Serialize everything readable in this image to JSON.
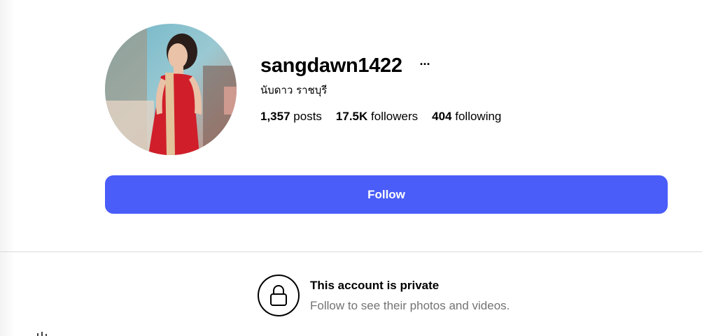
{
  "profile": {
    "username": "sangdawn1422",
    "more_icon": "···",
    "full_name": "นับดาว ราชบุรี",
    "avatar_icon": "profile-photo"
  },
  "stats": {
    "posts_count": "1,357",
    "posts_label": "posts",
    "followers_count": "17.5K",
    "followers_label": "followers",
    "following_count": "404",
    "following_label": "following"
  },
  "actions": {
    "follow_label": "Follow"
  },
  "private_notice": {
    "icon": "lock-icon",
    "title": "This account is private",
    "subtitle": "Follow to see their photos and videos."
  },
  "colors": {
    "follow_button": "#4a5df9",
    "divider": "#dbdbdb",
    "muted_text": "#737373"
  }
}
